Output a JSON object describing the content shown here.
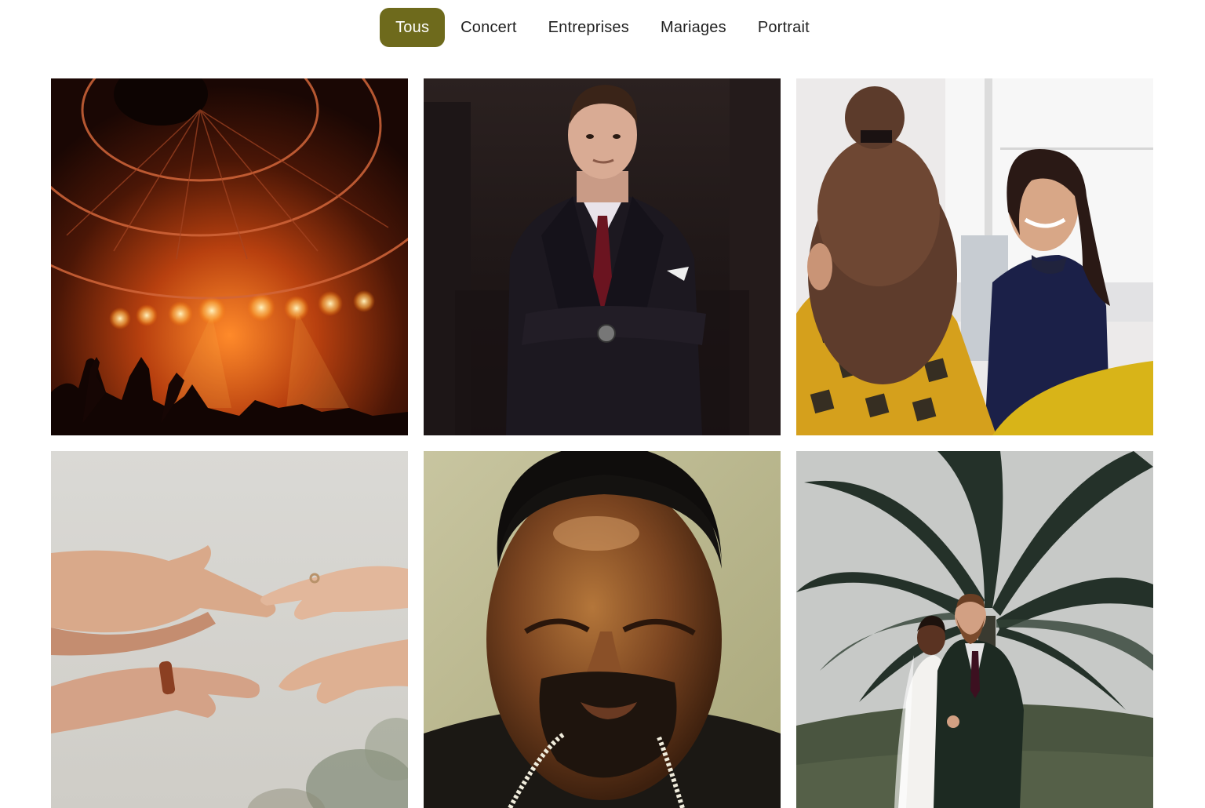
{
  "filters": [
    {
      "label": "Tous",
      "active": true
    },
    {
      "label": "Concert",
      "active": false
    },
    {
      "label": "Entreprises",
      "active": false
    },
    {
      "label": "Mariages",
      "active": false
    },
    {
      "label": "Portrait",
      "active": false
    }
  ],
  "colors": {
    "accent": "#6e6a1c",
    "text": "#222222",
    "background": "#ffffff"
  },
  "gallery": [
    {
      "category": "Concert"
    },
    {
      "category": "Portrait"
    },
    {
      "category": "Entreprises"
    },
    {
      "category": "Mariages"
    },
    {
      "category": "Portrait"
    },
    {
      "category": "Mariages"
    }
  ]
}
